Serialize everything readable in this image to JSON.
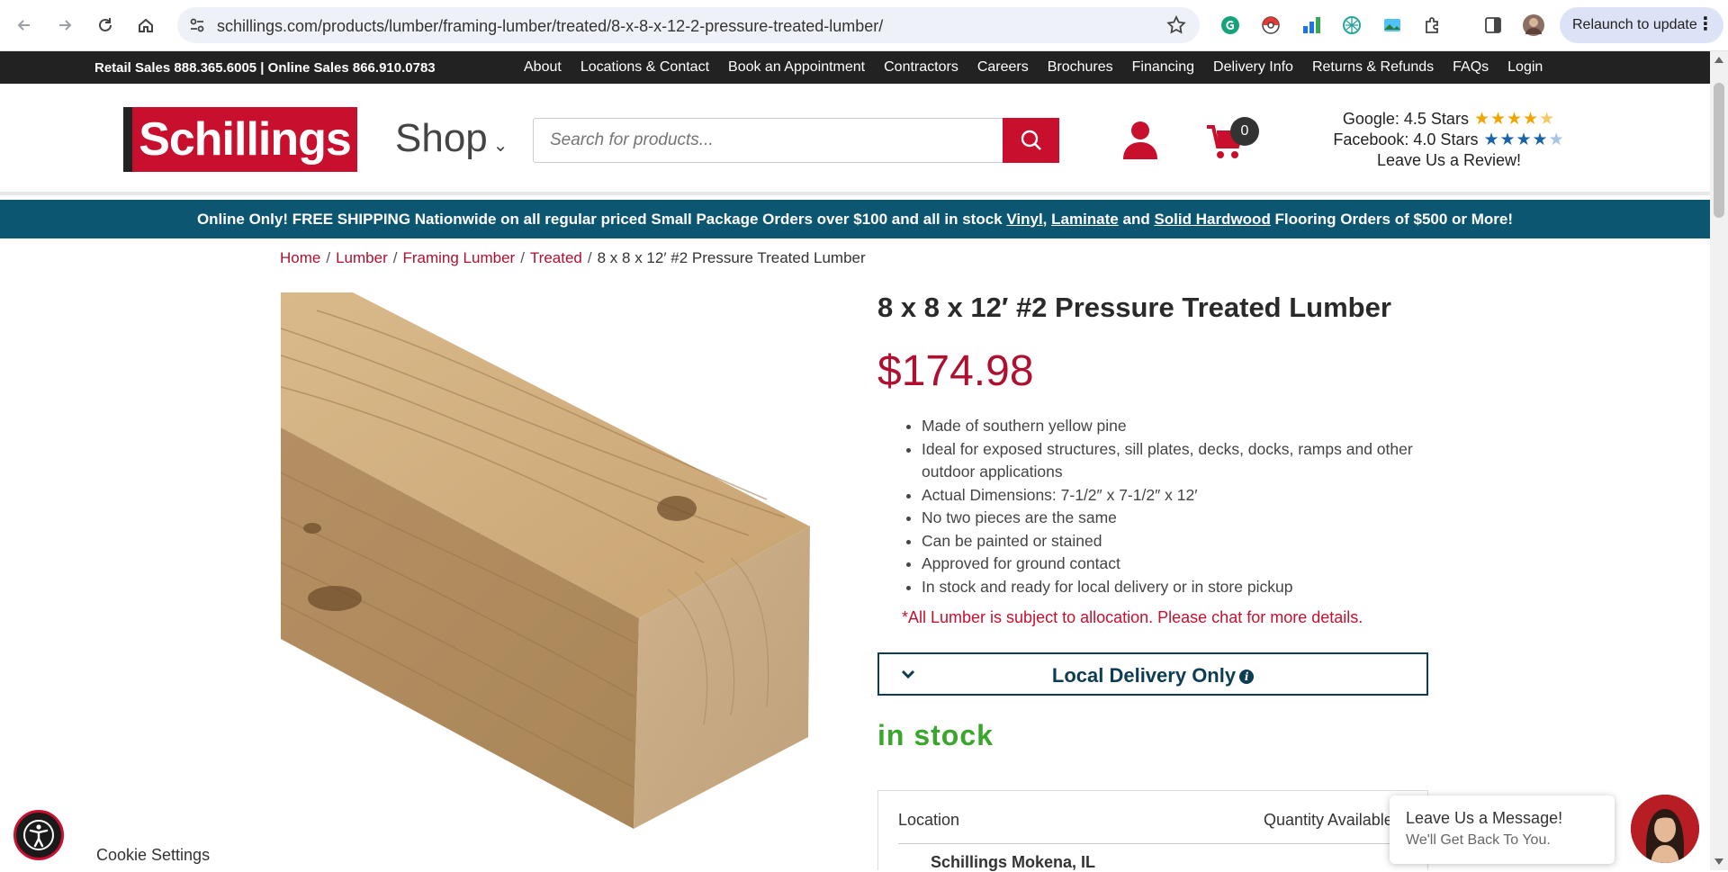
{
  "browser": {
    "url": "schillings.com/products/lumber/framing-lumber/treated/8-x-8-x-12-2-pressure-treated-lumber/",
    "relaunch_label": "Relaunch to update"
  },
  "topbar": {
    "phones": "Retail Sales 888.365.6005 | Online Sales 866.910.0783",
    "links": [
      "About",
      "Locations & Contact",
      "Book an Appointment",
      "Contractors",
      "Careers",
      "Brochures",
      "Financing",
      "Delivery Info",
      "Returns & Refunds",
      "FAQs",
      "Login"
    ]
  },
  "header": {
    "logo_text": "Schillings",
    "shop_label": "Shop",
    "search_placeholder": "Search for products...",
    "cart_count": "0",
    "google_rating": "Google: 4.5 Stars",
    "facebook_rating": "Facebook: 4.0 Stars",
    "review_cta": "Leave Us a Review!",
    "google_stars_value": 4.5,
    "facebook_stars_value": 4.0
  },
  "promo": {
    "text_before": "Online Only! FREE SHIPPING Nationwide on all regular priced Small Package Orders over $100 and all in stock ",
    "link1": "Vinyl",
    "comma": ", ",
    "link2": "Laminate",
    "and": " and ",
    "link3": "Solid Hardwood",
    "text_after": " Flooring Orders of $500 or More!"
  },
  "breadcrumb": {
    "items": [
      "Home",
      "Lumber",
      "Framing Lumber",
      "Treated"
    ],
    "current": "8 x 8 x 12′ #2 Pressure Treated Lumber",
    "separator": "/"
  },
  "product": {
    "title": "8 x 8 x 12′ #2 Pressure Treated Lumber",
    "price": "$174.98",
    "features": [
      "Made of southern yellow pine",
      "Ideal for exposed structures, sill plates, decks, docks, ramps and other outdoor applications",
      "Actual Dimensions: 7-1/2″ x 7-1/2″ x 12′",
      "No two pieces are the same",
      "Can be painted or stained",
      "Approved for ground contact",
      "In stock and ready for local delivery or in store pickup"
    ],
    "allocation_note": "*All Lumber is subject to allocation. Please chat for more details.",
    "delivery_label": "Local Delivery Only",
    "stock_status": "in stock",
    "location_header": "Location",
    "quantity_header": "Quantity Available",
    "first_location": "Schillings Mokena, IL"
  },
  "chat": {
    "title": "Leave Us a Message!",
    "subtitle": "We'll Get Back To You."
  },
  "footer": {
    "cookie_settings": "Cookie Settings"
  },
  "colors": {
    "brand_red": "#c8102e",
    "promo_teal": "#0d5672",
    "stock_green": "#3aa62b"
  }
}
